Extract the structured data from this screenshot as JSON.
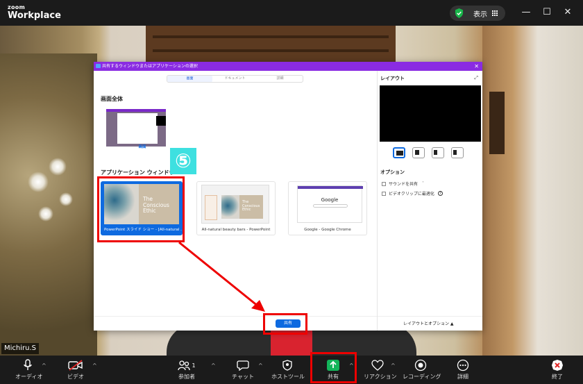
{
  "app": {
    "logo_small": "zoom",
    "logo_big": "Workplace",
    "view_label": "表示"
  },
  "window_controls": {
    "minimize": "—",
    "maximize": "☐",
    "close": "✕"
  },
  "video": {
    "participant_name": "Michiru.S"
  },
  "dialog": {
    "title": "共有するウィンドウまたはアプリケーションの選択",
    "close": "✕",
    "tabs": [
      "画面",
      "ドキュメント",
      "詳細"
    ],
    "section_screen": "画面全体",
    "screen_caption": "画面",
    "section_apps": "アプリケーション ウィンドウ",
    "apps": [
      {
        "caption": "PowerPoint スライド ショー - [All-natural ...",
        "slide_text": "The\nConscious\nEthic",
        "selected": true
      },
      {
        "caption": "All-natural beauty bars - PowerPoint",
        "slide_text": "The\nConscious\nEthic",
        "selected": false
      },
      {
        "caption": "Google - Google Chrome",
        "page_text": "Google",
        "selected": false
      }
    ],
    "share_button": "共有",
    "layout_title": "レイアウト",
    "options_title": "オプション",
    "option_sound": "サウンドを共有",
    "option_video": "ビデオクリップに最適化",
    "layout_options": "レイアウトとオプション ▲",
    "expand_icon": "⤢"
  },
  "annotation": {
    "step": "⑤"
  },
  "toolbar": {
    "audio": "オーディオ",
    "video": "ビデオ",
    "participants": "参加者",
    "participants_count": "1",
    "chat": "チャット",
    "host_tools": "ホストツール",
    "share": "共有",
    "reactions": "リアクション",
    "record": "レコーディング",
    "more": "詳細",
    "end": "終了",
    "caret": "^"
  },
  "colors": {
    "accent": "#0e6ae0",
    "dialog_title": "#8a2be2",
    "annotation": "#ee0000",
    "share_green": "#13b55a"
  }
}
